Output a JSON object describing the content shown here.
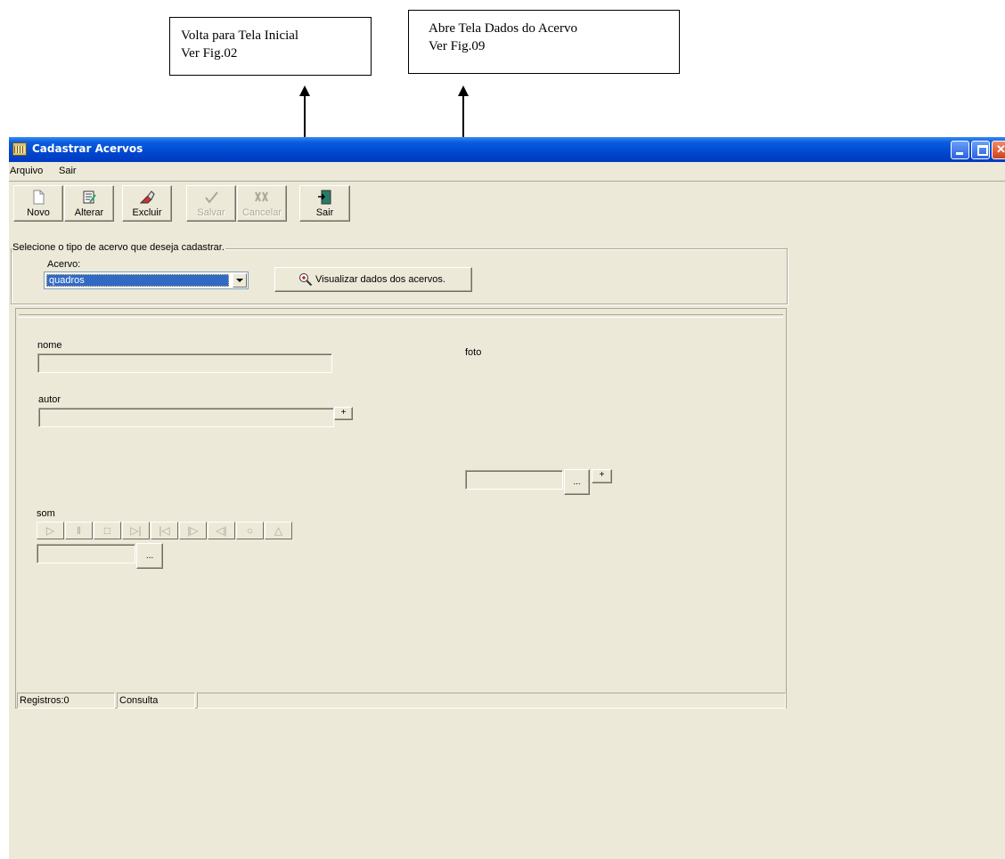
{
  "annotations": {
    "callout_left": {
      "line1": "Volta para Tela Inicial",
      "line2": "Ver Fig.02"
    },
    "callout_right": {
      "line1": "Abre Tela Dados do Acervo",
      "line2": "Ver Fig.09"
    }
  },
  "window": {
    "title": "Cadastrar Acervos"
  },
  "menu": {
    "arquivo": "Arquivo",
    "sair": "Sair"
  },
  "toolbar": {
    "novo": "Novo",
    "alterar": "Alterar",
    "excluir": "Excluir",
    "salvar": "Salvar",
    "cancelar": "Cancelar",
    "sair": "Sair"
  },
  "selection": {
    "group_caption": "Selecione o tipo de acervo que deseja cadastrar.",
    "acervo_label": "Acervo:",
    "acervo_value": "quadros",
    "view_button": "Visualizar dados dos acervos."
  },
  "form": {
    "nome_label": "nome",
    "autor_label": "autor",
    "foto_label": "foto",
    "som_label": "som",
    "plus": "+",
    "browse": "..."
  },
  "status": {
    "registros": "Registros:0",
    "mode": "Consulta"
  },
  "colors": {
    "titlebar": "#0a5ee0",
    "window_bg": "#ece9d8",
    "selection": "#316ac5"
  }
}
